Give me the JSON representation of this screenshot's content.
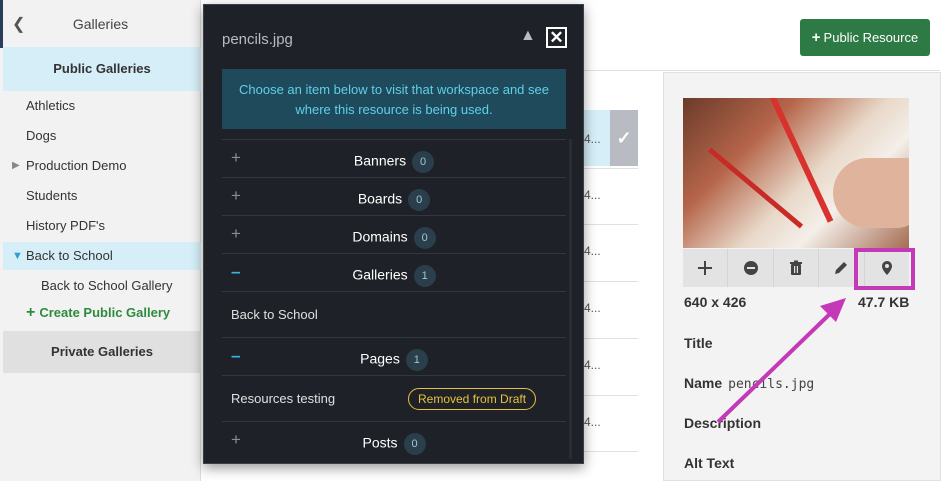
{
  "sidebar": {
    "back_icon": "chevron-left-icon",
    "title": "Galleries",
    "public_section": "Public Galleries",
    "items": [
      {
        "label": "Athletics"
      },
      {
        "label": "Dogs"
      },
      {
        "label": "Production Demo"
      },
      {
        "label": "Students"
      },
      {
        "label": "History PDF's"
      },
      {
        "label": "Back to School"
      },
      {
        "label": "Back to School Gallery"
      }
    ],
    "create_label": "Create Public Gallery",
    "private_section": "Private Galleries"
  },
  "header": {
    "public_resource_button": "Public Resource"
  },
  "list": {
    "ellipsis": "4..."
  },
  "modal": {
    "title": "pencils.jpg",
    "info": "Choose an item below to visit that workspace and see where this resource is being used.",
    "categories": [
      {
        "label": "Banners",
        "count": "0",
        "expanded": false
      },
      {
        "label": "Boards",
        "count": "0",
        "expanded": false
      },
      {
        "label": "Domains",
        "count": "0",
        "expanded": false
      },
      {
        "label": "Galleries",
        "count": "1",
        "expanded": true,
        "entries": [
          {
            "name": "Back to School"
          }
        ]
      },
      {
        "label": "Pages",
        "count": "1",
        "expanded": true,
        "entries": [
          {
            "name": "Resources testing",
            "status": "Removed from Draft"
          }
        ]
      },
      {
        "label": "Posts",
        "count": "0",
        "expanded": false
      }
    ]
  },
  "details": {
    "dimensions": "640 x 426",
    "file_size": "47.7 KB",
    "title_label": "Title",
    "name_label": "Name",
    "name_value": "pencils.jpg",
    "description_label": "Description",
    "alt_text_label": "Alt Text",
    "toolbar_icons": [
      "plus-icon",
      "minus-circle-icon",
      "trash-icon",
      "pencil-icon",
      "map-pin-icon"
    ]
  },
  "colors": {
    "accent_green": "#2d7a45",
    "highlight_magenta": "#c439b8",
    "modal_bg": "#1e2228",
    "info_text": "#5fd0e8",
    "badge_yellow": "#e8c23a"
  }
}
